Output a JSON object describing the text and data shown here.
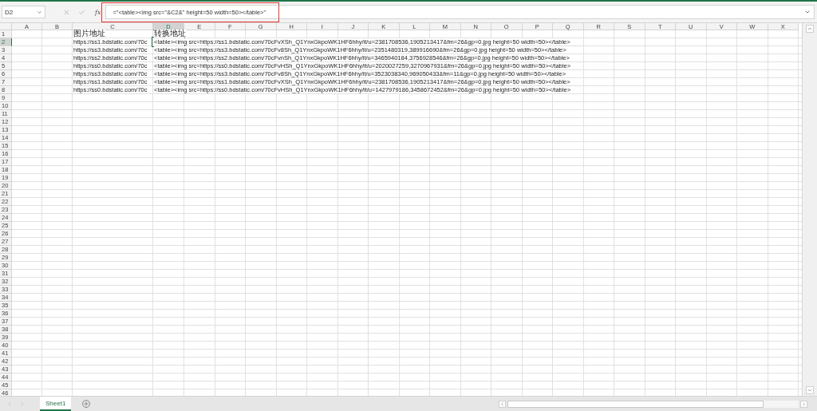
{
  "name_box": "D2",
  "formula_bar": {
    "fx_label": "fx",
    "value": "=\"<table><img src=\"&C2&\" height=50 width=50></table>\""
  },
  "columns": [
    {
      "label": "A",
      "selected": false
    },
    {
      "label": "B",
      "selected": false
    },
    {
      "label": "C",
      "selected": false
    },
    {
      "label": "D",
      "selected": true
    },
    {
      "label": "E",
      "selected": false
    },
    {
      "label": "F",
      "selected": false
    },
    {
      "label": "G",
      "selected": false
    },
    {
      "label": "H",
      "selected": false
    },
    {
      "label": "I",
      "selected": false
    },
    {
      "label": "J",
      "selected": false
    },
    {
      "label": "K",
      "selected": false
    },
    {
      "label": "L",
      "selected": false
    },
    {
      "label": "M",
      "selected": false
    },
    {
      "label": "N",
      "selected": false
    },
    {
      "label": "O",
      "selected": false
    },
    {
      "label": "P",
      "selected": false
    },
    {
      "label": "Q",
      "selected": false
    },
    {
      "label": "R",
      "selected": false
    },
    {
      "label": "S",
      "selected": false
    },
    {
      "label": "T",
      "selected": false
    },
    {
      "label": "U",
      "selected": false
    },
    {
      "label": "V",
      "selected": false
    },
    {
      "label": "W",
      "selected": false
    },
    {
      "label": "X",
      "selected": false
    }
  ],
  "rows": [
    {
      "label": "1",
      "selected": false,
      "column_c": "图片地址",
      "column_d": "转换地址"
    },
    {
      "label": "2",
      "selected": true,
      "column_c": "https://ss1.bdstatic.com/70c",
      "column_d": "<table><img src=https://ss1.bdstatic.com/70cFvXSh_Q1YnxGkpoWK1HF6hhy/it/u=2381708536,1905213417&fm=26&gp=0.jpg height=50 width=50></table>",
      "column_d_selected": true
    },
    {
      "label": "3",
      "selected": false,
      "column_c": "https://ss3.bdstatic.com/70c",
      "column_d": "<table><img src=https://ss3.bdstatic.com/70cFv8Sh_Q1YnxGkpoWK1HF6hhy/it/u=2351480319,389916690&fm=26&gp=0.jpg height=50 width=50></table>"
    },
    {
      "label": "4",
      "selected": false,
      "column_c": "https://ss2.bdstatic.com/70c",
      "column_d": "<table><img src=https://ss2.bdstatic.com/70cFvnSh_Q1YnxGkpoWK1HF6hhy/it/u=3465940184,3756928546&fm=26&gp=0.jpg height=50 width=50></table>"
    },
    {
      "label": "5",
      "selected": false,
      "column_c": "https://ss0.bdstatic.com/70c",
      "column_d": "<table><img src=https://ss0.bdstatic.com/70cFvHSh_Q1YnxGkpoWK1HF6hhy/it/u=2020027259,3270967931&fm=26&gp=0.jpg height=50 width=50></table>"
    },
    {
      "label": "6",
      "selected": false,
      "column_c": "https://ss3.bdstatic.com/70c",
      "column_d": "<table><img src=https://ss3.bdstatic.com/70cFv8Sh_Q1YnxGkpoWK1HF6hhy/it/u=3523038340,969050433&fm=11&gp=0.jpg height=50 width=50></table>"
    },
    {
      "label": "7",
      "selected": false,
      "column_c": "https://ss1.bdstatic.com/70c",
      "column_d": "<table><img src=https://ss1.bdstatic.com/70cFvXSh_Q1YnxGkpoWK1HF6hhy/it/u=2381708536,1905213417&fm=26&gp=0.jpg height=50 width=50></table>"
    },
    {
      "label": "8",
      "selected": false,
      "column_c": "https://ss0.bdstatic.com/70c",
      "column_d": "<table><img src=https://ss0.bdstatic.com/70cFvHSh_Q1YnxGkpoWK1HF6hhy/it/u=1427979186,3458672452&fm=26&gp=0.jpg height=50 width=50></table>"
    },
    {
      "label": "9",
      "selected": false
    },
    {
      "label": "10",
      "selected": false
    },
    {
      "label": "11",
      "selected": false
    },
    {
      "label": "12",
      "selected": false
    },
    {
      "label": "13",
      "selected": false
    },
    {
      "label": "14",
      "selected": false
    },
    {
      "label": "15",
      "selected": false
    },
    {
      "label": "16",
      "selected": false
    },
    {
      "label": "17",
      "selected": false
    },
    {
      "label": "18",
      "selected": false
    },
    {
      "label": "19",
      "selected": false
    },
    {
      "label": "20",
      "selected": false
    },
    {
      "label": "21",
      "selected": false
    },
    {
      "label": "22",
      "selected": false
    },
    {
      "label": "23",
      "selected": false
    },
    {
      "label": "24",
      "selected": false
    },
    {
      "label": "25",
      "selected": false
    },
    {
      "label": "26",
      "selected": false
    },
    {
      "label": "27",
      "selected": false
    },
    {
      "label": "28",
      "selected": false
    },
    {
      "label": "29",
      "selected": false
    },
    {
      "label": "30",
      "selected": false
    },
    {
      "label": "31",
      "selected": false
    },
    {
      "label": "32",
      "selected": false
    },
    {
      "label": "33",
      "selected": false
    },
    {
      "label": "34",
      "selected": false
    },
    {
      "label": "35",
      "selected": false
    },
    {
      "label": "36",
      "selected": false
    },
    {
      "label": "37",
      "selected": false
    },
    {
      "label": "38",
      "selected": false
    },
    {
      "label": "39",
      "selected": false
    },
    {
      "label": "40",
      "selected": false
    },
    {
      "label": "41",
      "selected": false
    },
    {
      "label": "42",
      "selected": false
    },
    {
      "label": "43",
      "selected": false
    },
    {
      "label": "44",
      "selected": false
    },
    {
      "label": "45",
      "selected": false
    },
    {
      "label": "46",
      "selected": false
    }
  ],
  "sheet_tabs": [
    {
      "label": "Sheet1",
      "selected": true
    }
  ]
}
